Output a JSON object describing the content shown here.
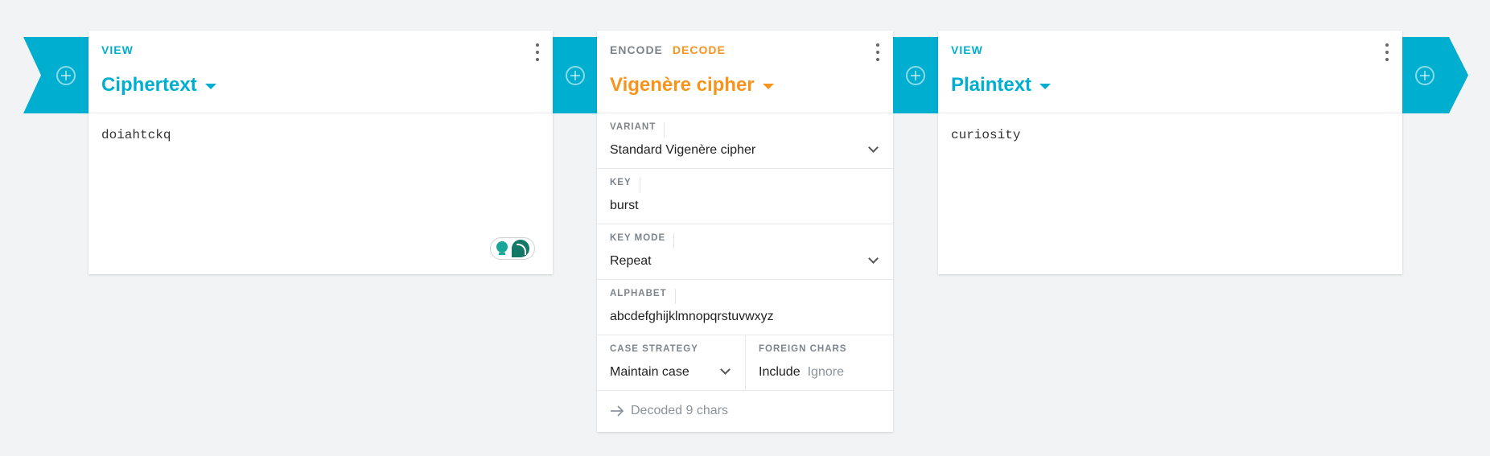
{
  "colors": {
    "accent": "#00aecf",
    "decode": "#f7941d",
    "background": "#f2f3f5"
  },
  "left_card": {
    "label": "VIEW",
    "title": "Ciphertext",
    "content": "doiahtckq"
  },
  "cipher_card": {
    "tabs": [
      "ENCODE",
      "DECODE"
    ],
    "active_tab": "DECODE",
    "title": "Vigenère cipher",
    "variant": {
      "label": "VARIANT",
      "value": "Standard Vigenère cipher"
    },
    "key": {
      "label": "KEY",
      "value": "burst"
    },
    "key_mode": {
      "label": "KEY MODE",
      "value": "Repeat"
    },
    "alphabet": {
      "label": "ALPHABET",
      "value": "abcdefghijklmnopqrstuvwxyz"
    },
    "case_strategy": {
      "label": "CASE STRATEGY",
      "value": "Maintain case"
    },
    "foreign_chars": {
      "label": "FOREIGN CHARS",
      "options": [
        "Include",
        "Ignore"
      ],
      "selected": "Include"
    },
    "status": "Decoded 9 chars"
  },
  "right_card": {
    "label": "VIEW",
    "title": "Plaintext",
    "content": "curiosity"
  },
  "icons": [
    "add-circle-icon",
    "more-vertical-icon",
    "caret-down-icon",
    "chevron-down-icon",
    "arrow-right-icon",
    "lightbulb-icon",
    "chat-bubble-icon"
  ]
}
